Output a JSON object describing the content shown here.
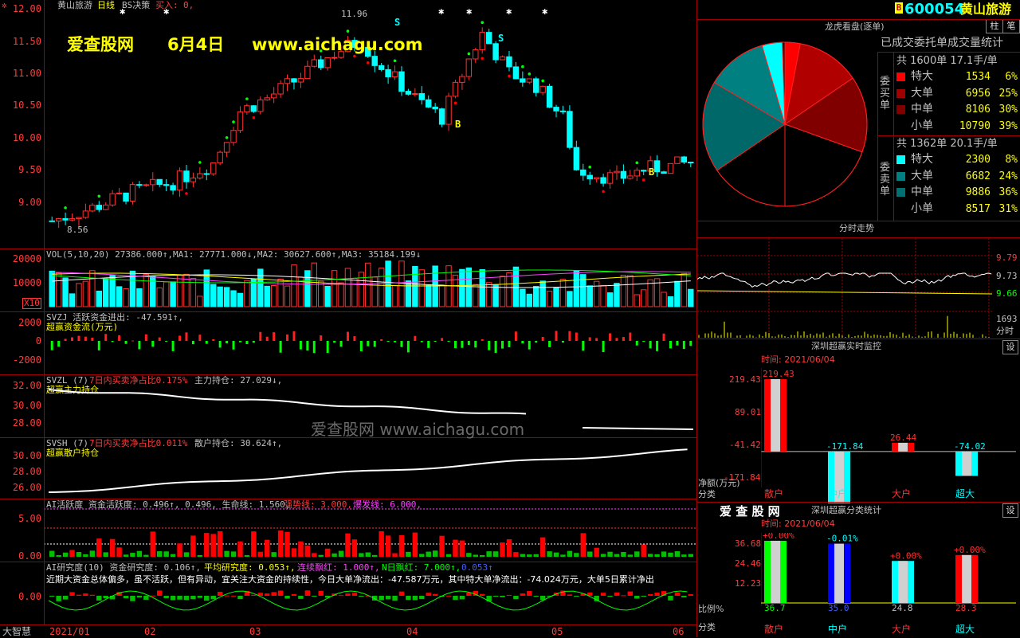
{
  "stock": {
    "code": "600054",
    "name": "黄山旅游",
    "flag": "B"
  },
  "main_chart": {
    "title": "黄山旅游",
    "period": "日线",
    "indicator": "BS决策",
    "signal_label": "买入:",
    "signal_value": "0,",
    "price_ticks": [
      "12.00",
      "11.50",
      "11.00",
      "10.50",
      "10.00",
      "9.50",
      "9.00"
    ],
    "max_label": "11.96",
    "min_label": "8.56",
    "watermark_site": "爱查股网",
    "watermark_date": "6月4日",
    "watermark_url": "www.aichagu.com",
    "s_label": "S",
    "b_label": "B"
  },
  "vol_panel": {
    "header": "VOL(5,10,20) 27386.000↑,MA1: 27771.000↓,MA2: 30627.600↑,MA3: 35184.199↓",
    "ticks": [
      "20000",
      "10000"
    ],
    "unit": "X10"
  },
  "svzj_panel": {
    "header": "SVZJ  活跃资金进出: -47.591↑,",
    "sub": "超赢资金流(万元)",
    "ticks": [
      "2000",
      "0",
      "-2000"
    ]
  },
  "svzl_panel": {
    "header_a": "SVZL (7)",
    "header_b": "7日内买卖净占比0.175%",
    "header_c": "主力持仓: 27.029↓,",
    "sub": "超赢主力持仓",
    "ticks": [
      "32.00",
      "30.00",
      "28.00"
    ]
  },
  "svsh_panel": {
    "header_a": "SVSH (7)",
    "header_b": "7日内买卖净占比0.011%",
    "header_c": "散户持仓: 30.624↑,",
    "sub": "超赢散户持仓",
    "ticks": [
      "30.00",
      "28.00",
      "26.00"
    ]
  },
  "ai_panel": {
    "header_a": "AI活跃度 资金活跃度: 0.496↑, 0.496, 生命线: 1.560,",
    "header_b": "强势线: 3.000,",
    "header_c": "爆发线: 6.000,",
    "ticks": [
      "5.00",
      "0.00"
    ]
  },
  "research_panel": {
    "header_a": "AI研究度(10) 资金研究度: 0.106↑,",
    "header_b": "平均研究度: 0.053↑,",
    "header_c": "连续飘红: 1.000↑,",
    "header_d": "N日飘红: 7.000↑,",
    "header_e": "0.053↑",
    "commentary": "近期大资金总体偏多，虽不活跃，但有异动，宜关注大资金的持续性，今日大单净流出：-47.587万元，其中特大单净流出：-74.024万元，大单5日累计净出",
    "ticks": [
      "0.00"
    ]
  },
  "watermark2": "爱查股网  www.aichagu.com",
  "brand_bottom": "大智慧",
  "x_axis": [
    "2021/01",
    "02",
    "03",
    "04",
    "05",
    "06"
  ],
  "top_buttons": [
    "柱",
    "笔"
  ],
  "dragon_tiger": {
    "title": "龙虎看盘(逐单)",
    "subtitle": "已成交委托单成交量统计",
    "buy_total": "共 1600单 17.1手/单",
    "sell_total": "共 1362单 20.1手/单",
    "buy_side_label": "委买单",
    "sell_side_label": "委卖单",
    "buy_rows": [
      {
        "label": "特大",
        "count": "1534",
        "pct": "6%",
        "color": "#ff0000"
      },
      {
        "label": "大单",
        "count": "6956",
        "pct": "25%",
        "color": "#a00000"
      },
      {
        "label": "中单",
        "count": "8106",
        "pct": "30%",
        "color": "#800000"
      },
      {
        "label": "小单",
        "count": "10790",
        "pct": "39%",
        "color": ""
      }
    ],
    "sell_rows": [
      {
        "label": "特大",
        "count": "2300",
        "pct": "8%",
        "color": "#00ffff"
      },
      {
        "label": "大单",
        "count": "6682",
        "pct": "24%",
        "color": "#008080"
      },
      {
        "label": "中单",
        "count": "9886",
        "pct": "36%",
        "color": "#007070"
      },
      {
        "label": "小单",
        "count": "8517",
        "pct": "31%",
        "color": ""
      }
    ]
  },
  "intraday": {
    "title": "分时走势",
    "ticks": [
      "9.79",
      "9.73",
      "9.66"
    ],
    "vol_tick": "1693",
    "vol_label": "分时"
  },
  "realtime_monitor": {
    "title": "深圳超赢实时监控",
    "settings": "设",
    "time": "时间: 2021/06/04",
    "ticks": [
      "219.43",
      "89.01",
      "-41.42",
      "-171.84"
    ],
    "ylabel": "净额(万元)",
    "xlabel": "分类",
    "categories": [
      "散户",
      "中户",
      "大户",
      "超大"
    ],
    "values": [
      "219.43",
      "-171.84",
      "26.44",
      "-74.02"
    ]
  },
  "class_stats": {
    "logo": "爱 查 股 网",
    "title": "深圳超赢分类统计",
    "settings": "设",
    "time": "时间: 2021/06/04",
    "ticks": [
      "36.68",
      "24.46",
      "12.23"
    ],
    "ylabel": "比例%",
    "xlabel": "分类",
    "categories": [
      "散户",
      "中户",
      "大户",
      "超大"
    ],
    "changes": [
      "+0.00%",
      "-0.01%",
      "+0.00%",
      "+0.00%"
    ],
    "values": [
      "36.7",
      "35.0",
      "24.8",
      "28.3"
    ]
  },
  "chart_data": {
    "type": "bar",
    "title": "深圳超赢实时监控",
    "categories": [
      "散户",
      "中户",
      "大户",
      "超大"
    ],
    "series": [
      {
        "name": "净额(万元)",
        "values": [
          219.43,
          -171.84,
          26.44,
          -74.02
        ]
      },
      {
        "name": "比例%",
        "values": [
          36.7,
          35.0,
          24.8,
          28.3
        ]
      }
    ]
  }
}
